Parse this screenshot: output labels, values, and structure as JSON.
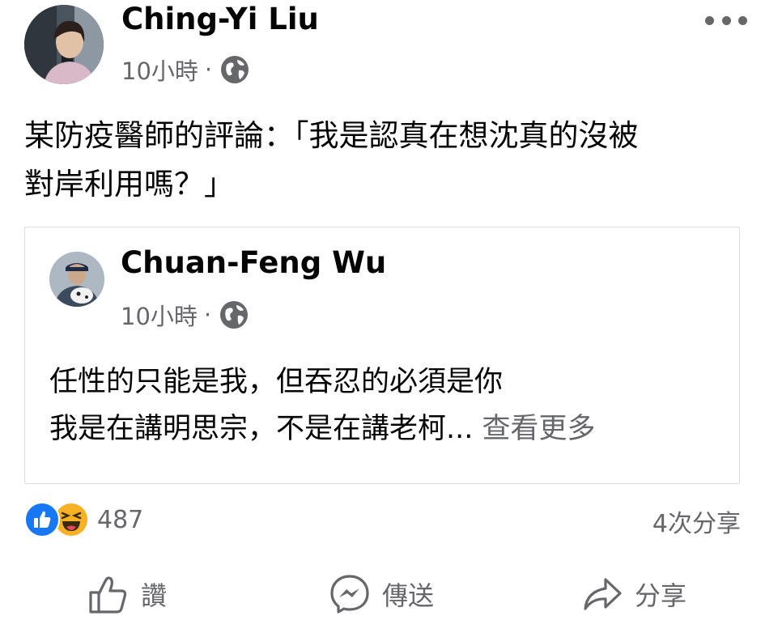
{
  "post": {
    "author": "Ching-Yi Liu",
    "time": "10小時",
    "separator": "·",
    "privacy_icon": "globe-icon",
    "text_lines": [
      "某防疫醫師的評論：「我是認真在想沈真的沒被",
      "對岸利用嗎？」"
    ]
  },
  "shared": {
    "author": "Chuan-Feng Wu",
    "time": "10小時",
    "separator": "·",
    "privacy_icon": "globe-icon",
    "line1": "任性的只能是我，但吞忍的必須是你",
    "line2": "我是在講明思宗，不是在講老柯...",
    "see_more": "查看更多"
  },
  "reactions": {
    "icons": [
      "like-icon",
      "haha-icon"
    ],
    "count": "487",
    "shares": "4次分享"
  },
  "actions": {
    "like": "讚",
    "send": "傳送",
    "share": "分享"
  },
  "colors": {
    "text": "#050505",
    "secondary": "#65676b",
    "like_blue": "#1877f2",
    "haha_yellow": "#f7b125",
    "border": "#dadde1"
  }
}
